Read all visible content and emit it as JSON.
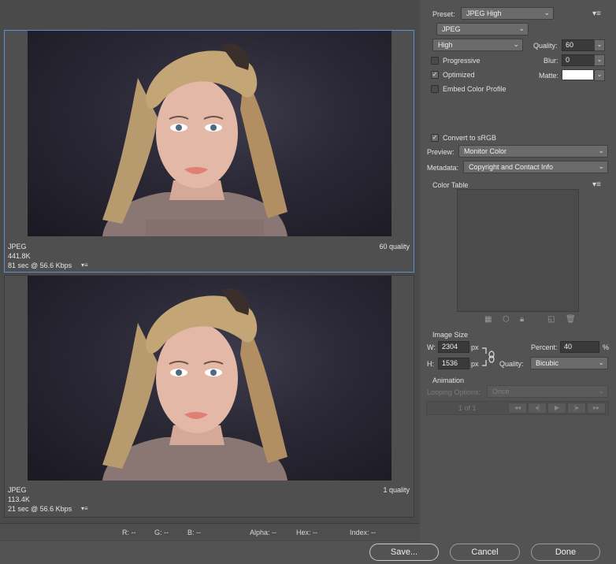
{
  "panes": [
    {
      "format": "JPEG",
      "quality": "60 quality",
      "size": "441.8K",
      "time": "81 sec @ 56.6 Kbps"
    },
    {
      "format": "JPEG",
      "quality": "1 quality",
      "size": "113.4K",
      "time": "21 sec @ 56.6 Kbps"
    }
  ],
  "status": {
    "r": "R: --",
    "g": "G: --",
    "b": "B: --",
    "alpha": "Alpha: --",
    "hex": "Hex: --",
    "index": "Index: --"
  },
  "settings": {
    "preset_label": "Preset:",
    "preset_value": "JPEG High",
    "format_value": "JPEG",
    "quality_level": "High",
    "quality_label": "Quality:",
    "quality_value": "60",
    "progressive_label": "Progressive",
    "progressive_checked": false,
    "blur_label": "Blur:",
    "blur_value": "0",
    "optimized_label": "Optimized",
    "optimized_checked": true,
    "matte_label": "Matte:",
    "embed_label": "Embed Color Profile",
    "embed_checked": false,
    "convert_label": "Convert to sRGB",
    "convert_checked": true,
    "preview_label": "Preview:",
    "preview_value": "Monitor Color",
    "metadata_label": "Metadata:",
    "metadata_value": "Copyright and Contact Info",
    "color_table_label": "Color Table",
    "matte_color": "#ffffff"
  },
  "image_size": {
    "title": "Image Size",
    "w_label": "W:",
    "w_value": "2304",
    "h_label": "H:",
    "h_value": "1536",
    "unit": "px",
    "percent_label": "Percent:",
    "percent_value": "40",
    "percent_unit": "%",
    "quality_label": "Quality:",
    "quality_value": "Bicubic"
  },
  "animation": {
    "title": "Animation",
    "looping_label": "Looping Options:",
    "looping_value": "Once",
    "frame_counter": "1 of 1"
  },
  "buttons": {
    "save": "Save...",
    "cancel": "Cancel",
    "done": "Done"
  },
  "icons": {
    "menu": "menu-icon",
    "link": "chain-link-icon"
  }
}
